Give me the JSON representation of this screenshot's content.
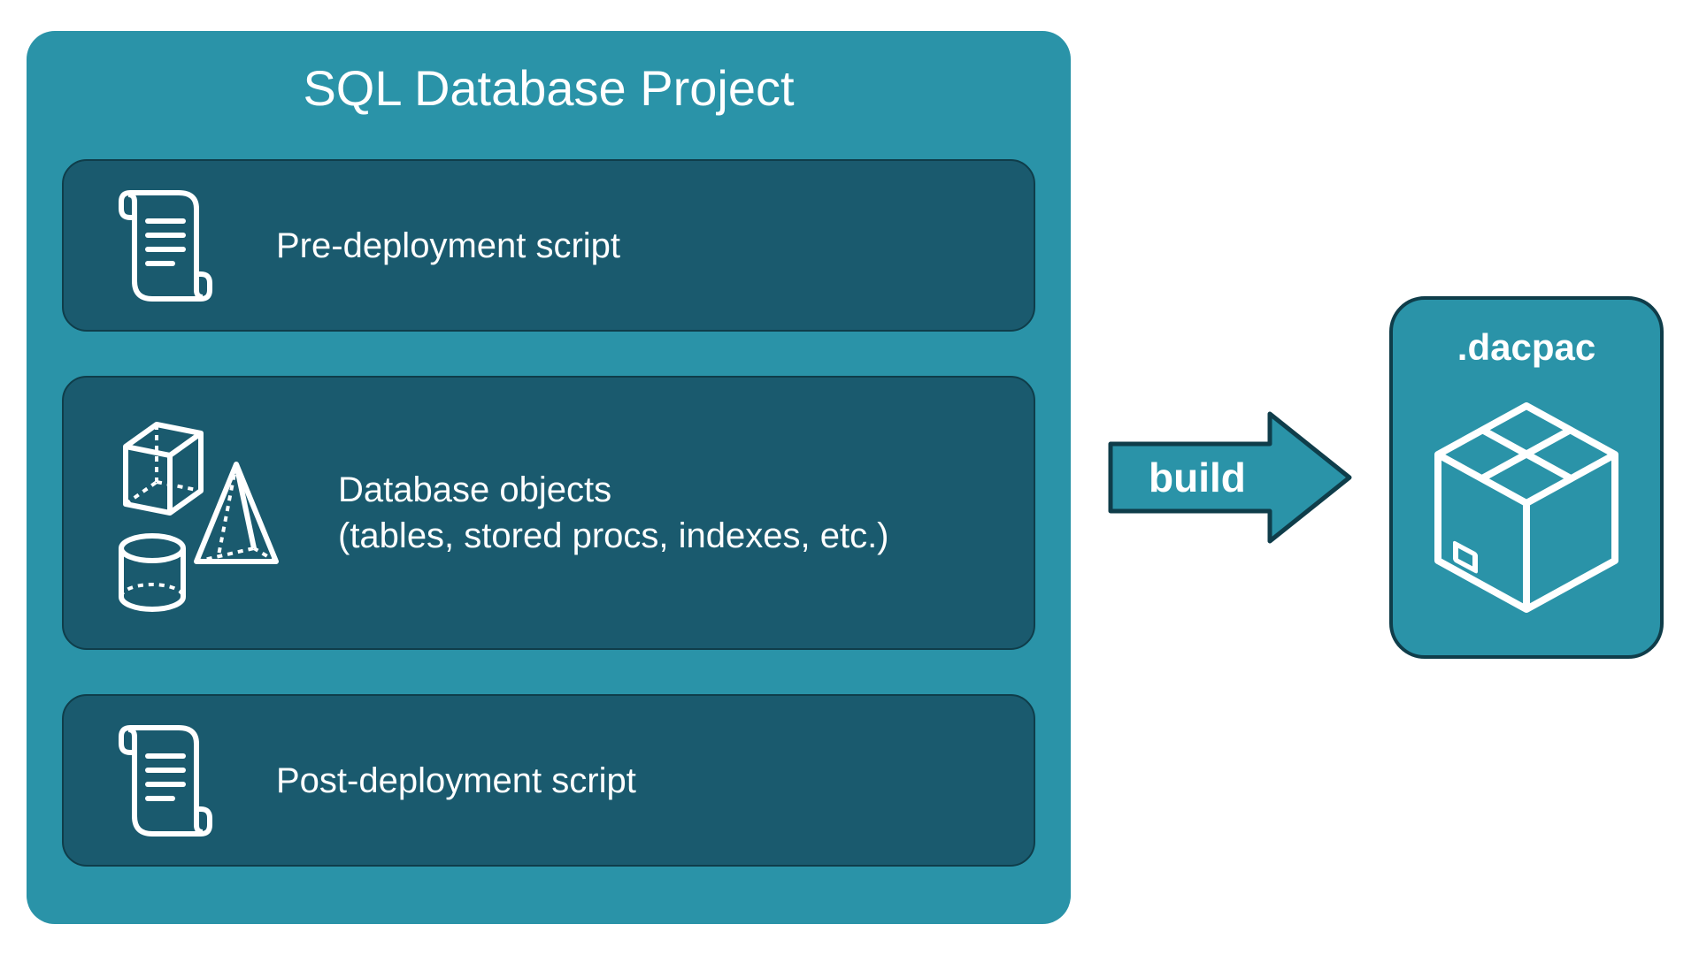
{
  "project": {
    "title": "SQL Database Project",
    "items": [
      {
        "label": "Pre-deployment script",
        "icon": "script-icon",
        "size": "small"
      },
      {
        "label": "Database objects\n(tables, stored procs, indexes, etc.)",
        "icon": "shapes-icon",
        "size": "large"
      },
      {
        "label": "Post-deployment script",
        "icon": "script-icon",
        "size": "small"
      }
    ]
  },
  "arrow": {
    "label": "build"
  },
  "output": {
    "label": ".dacpac",
    "icon": "package-icon"
  },
  "colors": {
    "teal_bg": "#2a93a8",
    "dark_teal": "#1a5a6e",
    "border_dark": "#0f3d4a",
    "white": "#ffffff"
  }
}
